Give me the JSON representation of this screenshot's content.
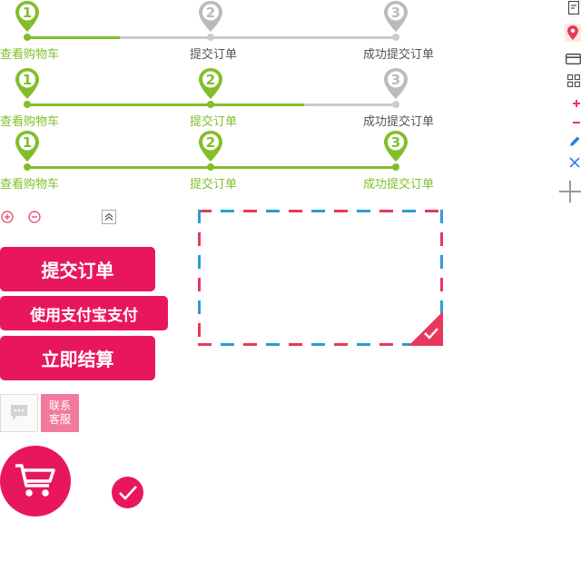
{
  "steppers": [
    {
      "labels": [
        "查看购物车",
        "提交订单",
        "成功提交订单"
      ],
      "numbers": [
        "1",
        "2",
        "3"
      ],
      "active_steps": 1,
      "progress": 0.25
    },
    {
      "labels": [
        "查看购物车",
        "提交订单",
        "成功提交订单"
      ],
      "numbers": [
        "1",
        "2",
        "3"
      ],
      "active_steps": 2,
      "progress": 0.75
    },
    {
      "labels": [
        "查看购物车",
        "提交订单",
        "成功提交订单"
      ],
      "numbers": [
        "1",
        "2",
        "3"
      ],
      "active_steps": 3,
      "progress": 1.0
    }
  ],
  "buttons": {
    "submit_order": "提交订单",
    "alipay": "使用支付宝支付",
    "checkout": "立即结算"
  },
  "contact": {
    "line1": "联系",
    "line2": "客服"
  },
  "icons": {
    "side": [
      "document-icon",
      "location-pin-icon",
      "card-icon",
      "grid-icon",
      "plus-icon",
      "minus-icon",
      "edit-pencil-icon",
      "close-icon",
      "add-large-icon"
    ],
    "zoom_in": "plus-circle-icon",
    "zoom_out": "minus-circle-icon",
    "collapse": "double-chevron-up-icon",
    "chat": "chat-bubble-icon",
    "cart": "shopping-cart-icon",
    "check": "check-icon"
  },
  "colors": {
    "accent": "#e8175d",
    "green": "#82be2a",
    "gray": "#cccccc",
    "airmail_blue": "#2d9ad8",
    "airmail_red": "#e8375d"
  }
}
